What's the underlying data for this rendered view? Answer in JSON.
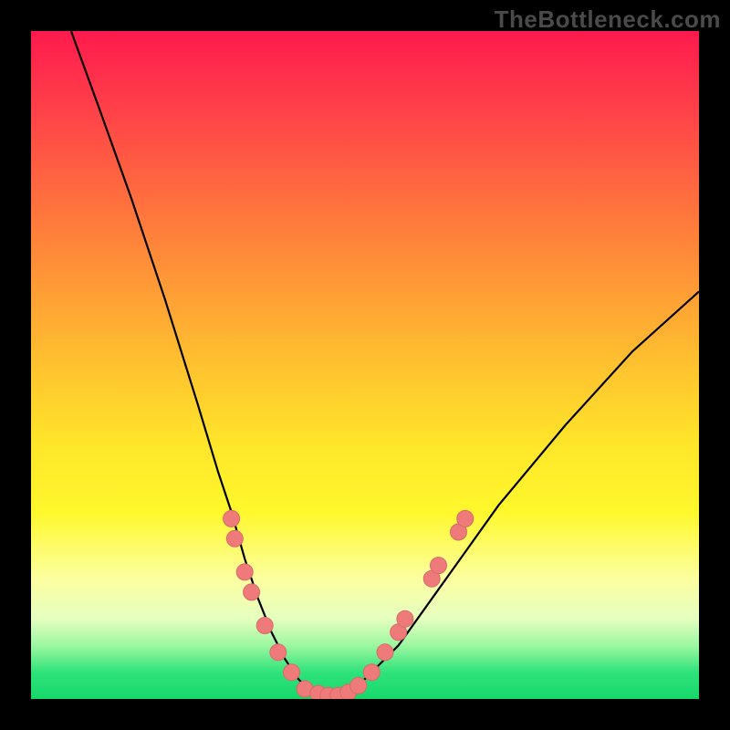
{
  "branding": {
    "site": "TheBottleneck.com"
  },
  "chart_data": {
    "type": "line",
    "title": "",
    "xlabel": "",
    "ylabel": "",
    "xlim": [
      0,
      100
    ],
    "ylim": [
      0,
      100
    ],
    "series": [
      {
        "name": "bottleneck-curve",
        "x": [
          6,
          10,
          15,
          20,
          25,
          28,
          30,
          32,
          34,
          36,
          38,
          40,
          42,
          44,
          46,
          48,
          50,
          55,
          60,
          65,
          70,
          80,
          90,
          100
        ],
        "y": [
          100,
          89,
          75,
          60,
          44,
          34,
          28,
          21,
          15,
          10,
          6,
          3,
          1,
          0,
          0,
          1,
          3,
          8,
          15,
          22,
          29,
          41,
          52,
          61
        ]
      }
    ],
    "markers": [
      {
        "name": "left-dot-1",
        "x": 30.0,
        "y": 27
      },
      {
        "name": "left-dot-2",
        "x": 30.5,
        "y": 24
      },
      {
        "name": "left-dot-3",
        "x": 32.0,
        "y": 19
      },
      {
        "name": "left-dot-4",
        "x": 33.0,
        "y": 16
      },
      {
        "name": "left-dot-5",
        "x": 35.0,
        "y": 11
      },
      {
        "name": "left-dot-6",
        "x": 37.0,
        "y": 7
      },
      {
        "name": "left-dot-7",
        "x": 39.0,
        "y": 4
      },
      {
        "name": "bottom-dot-1",
        "x": 41.0,
        "y": 1.5
      },
      {
        "name": "bottom-dot-2",
        "x": 43.0,
        "y": 0.8
      },
      {
        "name": "bottom-dot-3",
        "x": 44.5,
        "y": 0.5
      },
      {
        "name": "bottom-dot-4",
        "x": 46.0,
        "y": 0.5
      },
      {
        "name": "bottom-dot-5",
        "x": 47.5,
        "y": 1.0
      },
      {
        "name": "bottom-dot-6",
        "x": 49.0,
        "y": 2.0
      },
      {
        "name": "right-dot-1",
        "x": 51.0,
        "y": 4
      },
      {
        "name": "right-dot-2",
        "x": 53.0,
        "y": 7
      },
      {
        "name": "right-dot-3",
        "x": 55.0,
        "y": 10
      },
      {
        "name": "right-dot-4",
        "x": 56.0,
        "y": 12
      },
      {
        "name": "right-dot-5",
        "x": 60.0,
        "y": 18
      },
      {
        "name": "right-dot-6",
        "x": 61.0,
        "y": 20
      },
      {
        "name": "right-dot-7",
        "x": 64.0,
        "y": 25
      },
      {
        "name": "right-dot-8",
        "x": 65.0,
        "y": 27
      }
    ],
    "colors": {
      "curve": "#000000",
      "marker_fill": "#ef7a7a",
      "marker_stroke": "#d86a6a",
      "gradient_top": "#ff1a4d",
      "gradient_bottom": "#17d86b"
    }
  }
}
